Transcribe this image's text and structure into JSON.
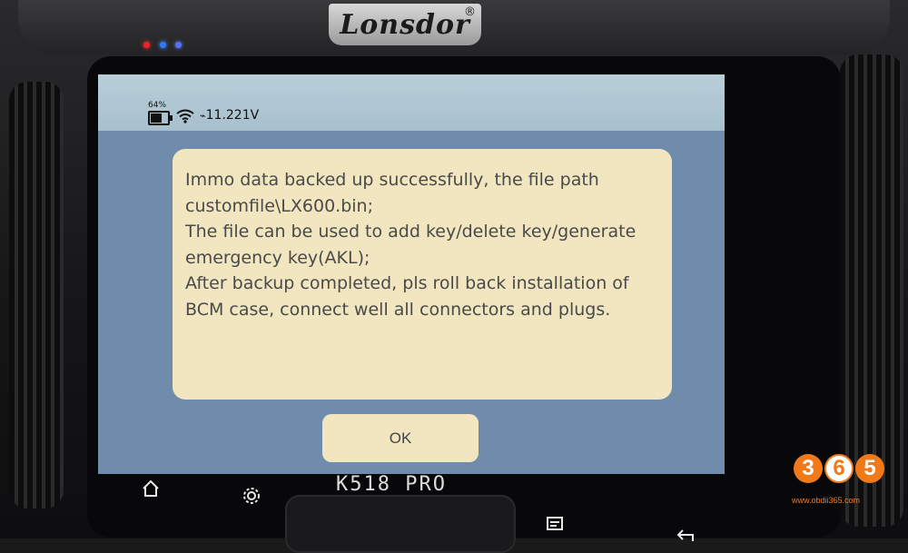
{
  "device": {
    "brand": "Lonsdor",
    "registered_mark": "®",
    "model": "K518 PRO"
  },
  "statusbar": {
    "battery_percent": "64%",
    "battery_level": 0.64,
    "voltage_symbol": "⌁",
    "voltage": "11.221V",
    "wifi_icon": "wifi-icon"
  },
  "dialog": {
    "lines": [
      "Immo data backed up successfully, the file path",
      "customfile\\LX600.bin;",
      "The file can be used to add key/delete key/generate",
      "emergency key(AKL);",
      "After backup completed, pls roll back installation of",
      "BCM case, connect well all connectors and plugs."
    ],
    "ok_label": "OK"
  },
  "nav": {
    "home_icon": "home-icon",
    "settings_icon": "gear-icon",
    "message_icon": "message-icon",
    "back_icon": "back-icon"
  },
  "watermark": {
    "digits": [
      "3",
      "6",
      "5"
    ],
    "url": "www.obdii365.com"
  },
  "colors": {
    "dialog_bg": "#f1e6c0",
    "screen_bg": "#6f8cad",
    "statusbar_bg": "#b9ced9",
    "watermark": "#f07a1a"
  }
}
